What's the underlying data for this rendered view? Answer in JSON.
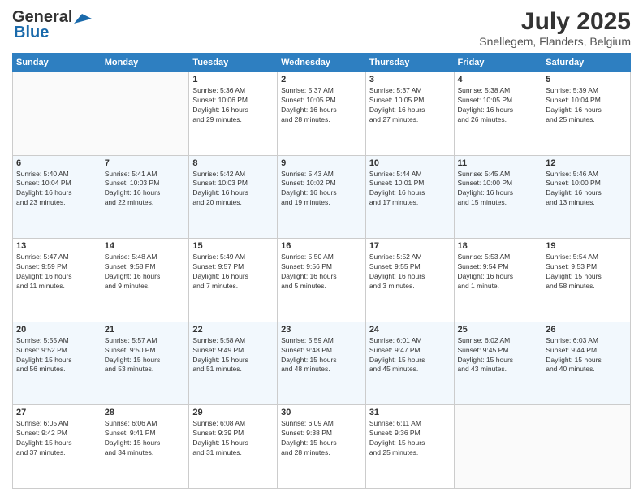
{
  "header": {
    "logo_general": "General",
    "logo_blue": "Blue",
    "month_title": "July 2025",
    "location": "Snellegem, Flanders, Belgium"
  },
  "days_of_week": [
    "Sunday",
    "Monday",
    "Tuesday",
    "Wednesday",
    "Thursday",
    "Friday",
    "Saturday"
  ],
  "weeks": [
    [
      {
        "num": "",
        "info": ""
      },
      {
        "num": "",
        "info": ""
      },
      {
        "num": "1",
        "info": "Sunrise: 5:36 AM\nSunset: 10:06 PM\nDaylight: 16 hours\nand 29 minutes."
      },
      {
        "num": "2",
        "info": "Sunrise: 5:37 AM\nSunset: 10:05 PM\nDaylight: 16 hours\nand 28 minutes."
      },
      {
        "num": "3",
        "info": "Sunrise: 5:37 AM\nSunset: 10:05 PM\nDaylight: 16 hours\nand 27 minutes."
      },
      {
        "num": "4",
        "info": "Sunrise: 5:38 AM\nSunset: 10:05 PM\nDaylight: 16 hours\nand 26 minutes."
      },
      {
        "num": "5",
        "info": "Sunrise: 5:39 AM\nSunset: 10:04 PM\nDaylight: 16 hours\nand 25 minutes."
      }
    ],
    [
      {
        "num": "6",
        "info": "Sunrise: 5:40 AM\nSunset: 10:04 PM\nDaylight: 16 hours\nand 23 minutes."
      },
      {
        "num": "7",
        "info": "Sunrise: 5:41 AM\nSunset: 10:03 PM\nDaylight: 16 hours\nand 22 minutes."
      },
      {
        "num": "8",
        "info": "Sunrise: 5:42 AM\nSunset: 10:03 PM\nDaylight: 16 hours\nand 20 minutes."
      },
      {
        "num": "9",
        "info": "Sunrise: 5:43 AM\nSunset: 10:02 PM\nDaylight: 16 hours\nand 19 minutes."
      },
      {
        "num": "10",
        "info": "Sunrise: 5:44 AM\nSunset: 10:01 PM\nDaylight: 16 hours\nand 17 minutes."
      },
      {
        "num": "11",
        "info": "Sunrise: 5:45 AM\nSunset: 10:00 PM\nDaylight: 16 hours\nand 15 minutes."
      },
      {
        "num": "12",
        "info": "Sunrise: 5:46 AM\nSunset: 10:00 PM\nDaylight: 16 hours\nand 13 minutes."
      }
    ],
    [
      {
        "num": "13",
        "info": "Sunrise: 5:47 AM\nSunset: 9:59 PM\nDaylight: 16 hours\nand 11 minutes."
      },
      {
        "num": "14",
        "info": "Sunrise: 5:48 AM\nSunset: 9:58 PM\nDaylight: 16 hours\nand 9 minutes."
      },
      {
        "num": "15",
        "info": "Sunrise: 5:49 AM\nSunset: 9:57 PM\nDaylight: 16 hours\nand 7 minutes."
      },
      {
        "num": "16",
        "info": "Sunrise: 5:50 AM\nSunset: 9:56 PM\nDaylight: 16 hours\nand 5 minutes."
      },
      {
        "num": "17",
        "info": "Sunrise: 5:52 AM\nSunset: 9:55 PM\nDaylight: 16 hours\nand 3 minutes."
      },
      {
        "num": "18",
        "info": "Sunrise: 5:53 AM\nSunset: 9:54 PM\nDaylight: 16 hours\nand 1 minute."
      },
      {
        "num": "19",
        "info": "Sunrise: 5:54 AM\nSunset: 9:53 PM\nDaylight: 15 hours\nand 58 minutes."
      }
    ],
    [
      {
        "num": "20",
        "info": "Sunrise: 5:55 AM\nSunset: 9:52 PM\nDaylight: 15 hours\nand 56 minutes."
      },
      {
        "num": "21",
        "info": "Sunrise: 5:57 AM\nSunset: 9:50 PM\nDaylight: 15 hours\nand 53 minutes."
      },
      {
        "num": "22",
        "info": "Sunrise: 5:58 AM\nSunset: 9:49 PM\nDaylight: 15 hours\nand 51 minutes."
      },
      {
        "num": "23",
        "info": "Sunrise: 5:59 AM\nSunset: 9:48 PM\nDaylight: 15 hours\nand 48 minutes."
      },
      {
        "num": "24",
        "info": "Sunrise: 6:01 AM\nSunset: 9:47 PM\nDaylight: 15 hours\nand 45 minutes."
      },
      {
        "num": "25",
        "info": "Sunrise: 6:02 AM\nSunset: 9:45 PM\nDaylight: 15 hours\nand 43 minutes."
      },
      {
        "num": "26",
        "info": "Sunrise: 6:03 AM\nSunset: 9:44 PM\nDaylight: 15 hours\nand 40 minutes."
      }
    ],
    [
      {
        "num": "27",
        "info": "Sunrise: 6:05 AM\nSunset: 9:42 PM\nDaylight: 15 hours\nand 37 minutes."
      },
      {
        "num": "28",
        "info": "Sunrise: 6:06 AM\nSunset: 9:41 PM\nDaylight: 15 hours\nand 34 minutes."
      },
      {
        "num": "29",
        "info": "Sunrise: 6:08 AM\nSunset: 9:39 PM\nDaylight: 15 hours\nand 31 minutes."
      },
      {
        "num": "30",
        "info": "Sunrise: 6:09 AM\nSunset: 9:38 PM\nDaylight: 15 hours\nand 28 minutes."
      },
      {
        "num": "31",
        "info": "Sunrise: 6:11 AM\nSunset: 9:36 PM\nDaylight: 15 hours\nand 25 minutes."
      },
      {
        "num": "",
        "info": ""
      },
      {
        "num": "",
        "info": ""
      }
    ]
  ]
}
